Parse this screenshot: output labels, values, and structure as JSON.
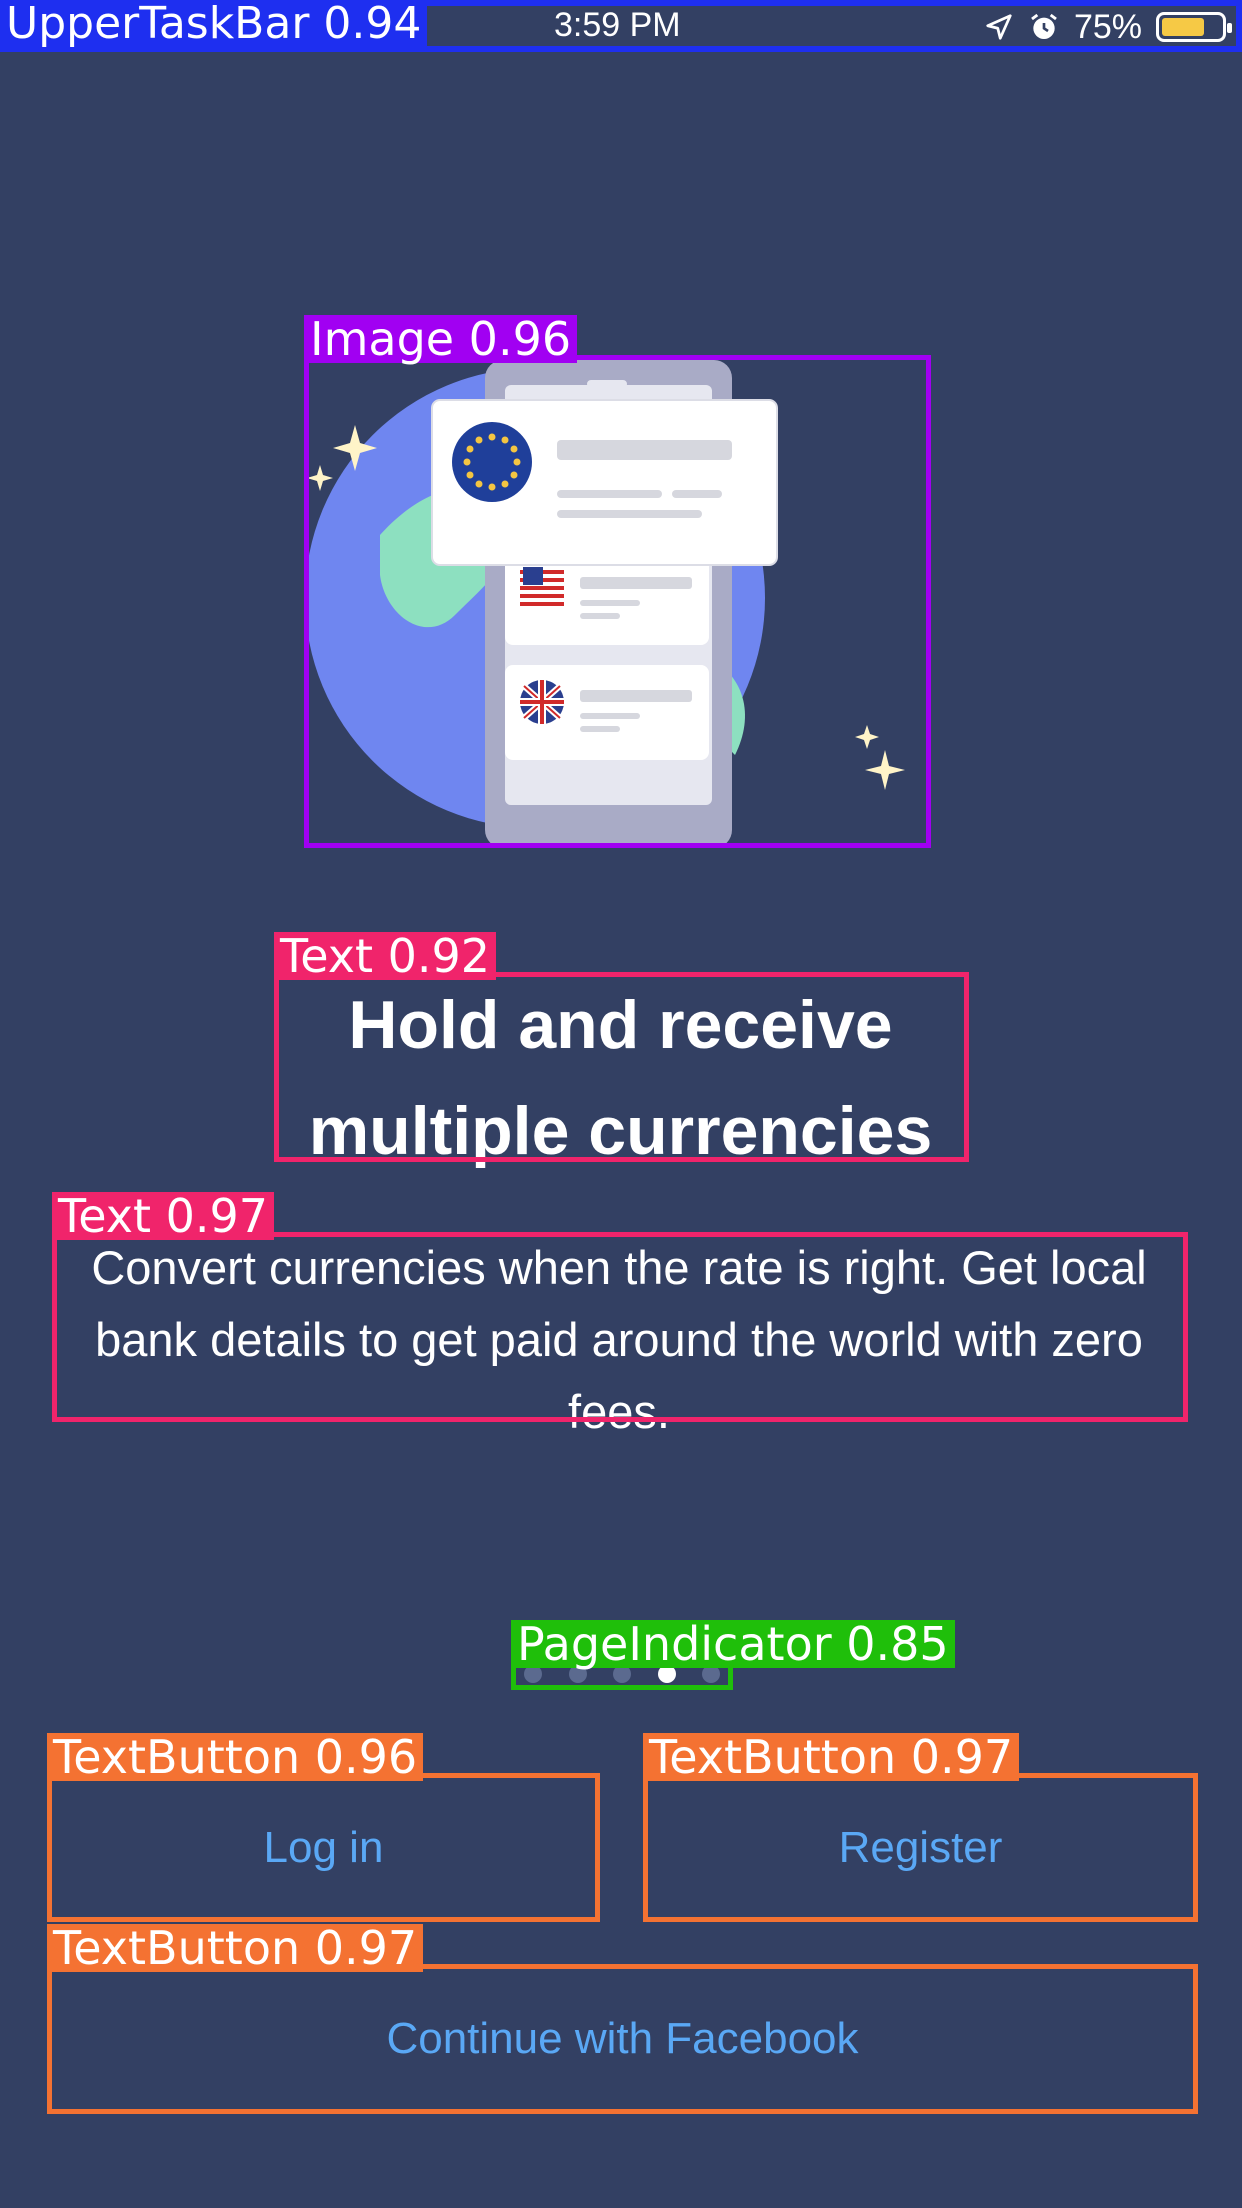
{
  "status_bar": {
    "time": "3:59 PM",
    "battery": "75%",
    "battery_level": 0.75
  },
  "labels": {
    "upper_taskbar": "UpperTaskBar 0.94",
    "image": "Image 0.96",
    "text_title": "Text 0.92",
    "text_desc": "Text 0.97",
    "page_indicator": "PageIndicator 0.85",
    "btn_login": "TextButton 0.96",
    "btn_register": "TextButton 0.97",
    "btn_facebook": "TextButton 0.97"
  },
  "onboarding": {
    "title": "Hold and receive multiple currencies",
    "description": "Convert currencies when the rate is right. Get local bank details to get paid around the world with zero fees.",
    "page_count": 5,
    "active_page": 4
  },
  "buttons": {
    "login": "Log in",
    "register": "Register",
    "facebook": "Continue with Facebook"
  },
  "colors": {
    "background": "#334063",
    "accent_text": "#5aa8f5",
    "taskbar_box": "#1e2ff0",
    "image_box": "#a100f2",
    "text_box": "#f0246b",
    "indicator_box": "#1fbf0a",
    "button_box": "#f47232"
  }
}
